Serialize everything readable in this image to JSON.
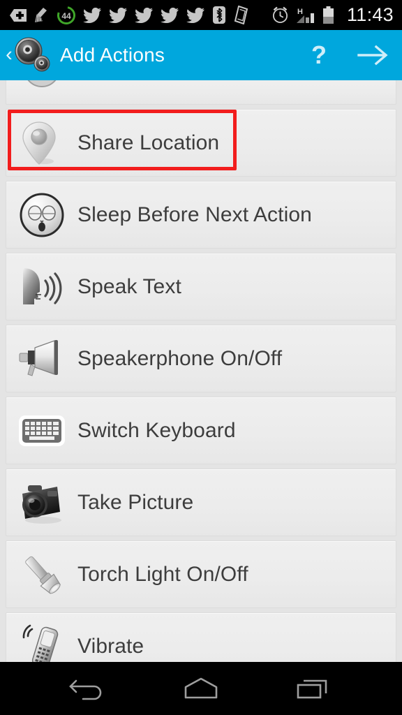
{
  "status_bar": {
    "time": "11:43",
    "left_icons": [
      {
        "name": "sd-card-plus-icon"
      },
      {
        "name": "clean-broom-icon"
      },
      {
        "name": "battery-saver-44-icon",
        "value": "44"
      },
      {
        "name": "twitter-icon"
      },
      {
        "name": "twitter-icon"
      },
      {
        "name": "twitter-icon"
      },
      {
        "name": "twitter-icon"
      },
      {
        "name": "twitter-icon"
      },
      {
        "name": "bluetooth-icon"
      },
      {
        "name": "vibrate-mode-icon"
      }
    ],
    "right_icons": [
      {
        "name": "alarm-clock-icon"
      },
      {
        "name": "hspa-signal-icon",
        "label": "H"
      },
      {
        "name": "battery-icon"
      }
    ]
  },
  "header": {
    "back_glyph": "‹",
    "logo_icon": "gears-logo-icon",
    "title": "Add Actions",
    "help_label": "?",
    "next_icon": "arrow-right-icon",
    "background_color": "#00a7dd"
  },
  "highlight": {
    "color": "#f21d1d",
    "target": "Share Location"
  },
  "list": {
    "partial_top_row": {
      "icon": "circle-icon",
      "label": ""
    },
    "items": [
      {
        "label": "Share Location",
        "icon": "map-pin-icon",
        "highlighted": true
      },
      {
        "label": "Sleep Before Next Action",
        "icon": "sleeping-face-icon",
        "highlighted": false
      },
      {
        "label": "Speak Text",
        "icon": "speaking-head-icon",
        "highlighted": false
      },
      {
        "label": "Speakerphone On/Off",
        "icon": "megaphone-icon",
        "highlighted": false
      },
      {
        "label": "Switch Keyboard",
        "icon": "keyboard-icon",
        "highlighted": false
      },
      {
        "label": "Take Picture",
        "icon": "camera-icon",
        "highlighted": false
      },
      {
        "label": "Torch Light On/Off",
        "icon": "flashlight-icon",
        "highlighted": false
      },
      {
        "label": "Vibrate",
        "icon": "vibrating-phone-icon",
        "highlighted": false
      }
    ]
  },
  "nav_bar": {
    "buttons": [
      {
        "name": "back-icon"
      },
      {
        "name": "home-icon"
      },
      {
        "name": "recents-icon"
      }
    ]
  }
}
